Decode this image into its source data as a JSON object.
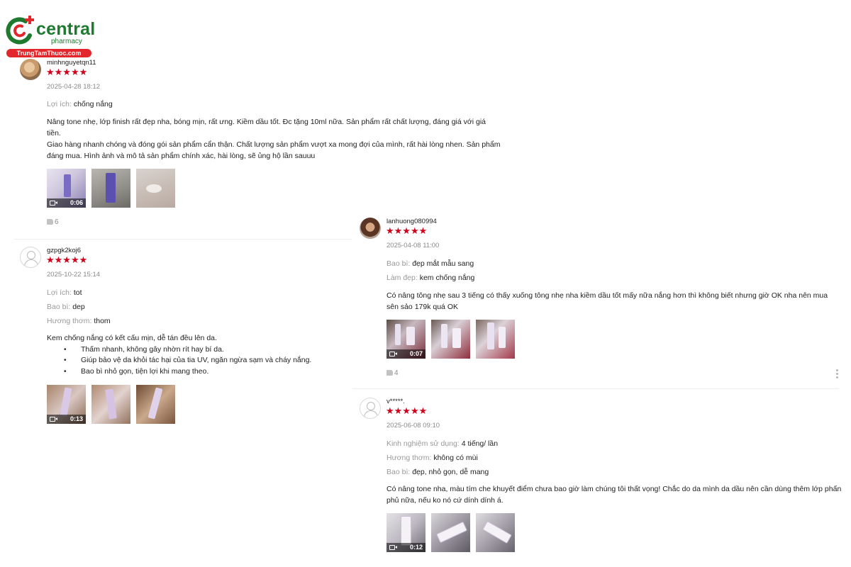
{
  "logo": {
    "brand": "central",
    "sub": "pharmacy",
    "url": "TrungTamThuoc.com"
  },
  "reviews": [
    {
      "username": "minhnguyetqn11",
      "stars": "★★★★★",
      "rating": 5,
      "date": "2025-04-28 18:12",
      "attributes": [
        {
          "label": "Lợi ích:",
          "value": "chống nắng"
        }
      ],
      "paragraphs": [
        "Nâng tone nhẹ, lớp finish rất đẹp nha, bóng mịn, rất ưng. Kiềm dầu tốt. Đc tặng 10ml nữa. Sản phẩm rất chất lượng, đáng giá với giá tiền.",
        "Giao hàng nhanh chóng và đóng gói sản phẩm cẩn thận. Chất lượng sản phẩm vượt xa mong đợi của mình, rất hài lòng nhen. Sản phẩm đáng mua. Hình ảnh và mô tả sản phẩm chính xác, hài lòng, sẽ ủng hộ lần sauuu"
      ],
      "video_duration": "0:06",
      "likes": "6"
    },
    {
      "username": "gzpgk2koj6",
      "stars": "★★★★★",
      "rating": 5,
      "date": "2025-10-22 15:14",
      "attributes": [
        {
          "label": "Lợi ích:",
          "value": "tot"
        },
        {
          "label": "Bao bì:",
          "value": "dep"
        },
        {
          "label": "Hương thơm:",
          "value": "thom"
        }
      ],
      "intro": "Kem chống nắng có kết cấu mịn, dễ tán đều lên da.",
      "bullets": [
        "Thấm nhanh, không gây nhờn rít hay bí da.",
        "Giúp bảo vệ da khỏi tác hại của tia UV, ngăn ngừa sạm và cháy nắng.",
        "Bao bì nhỏ gọn, tiện lợi khi mang theo."
      ],
      "video_duration": "0:13"
    },
    {
      "username": "lanhuong080994",
      "stars": "★★★★★",
      "rating": 5,
      "date": "2025-04-08 11:00",
      "attributes": [
        {
          "label": "Bao bì:",
          "value": "đẹp mắt mẫu sang"
        },
        {
          "label": "Làm đẹp:",
          "value": "kem chống nắng"
        }
      ],
      "paragraphs": [
        "Có nâng tông nhẹ sau 3 tiếng có thấy xuống tông nhẹ nha kiềm dầu tốt mấy nữa nắng hơn thì không biết nhưng giờ OK nha nên mua sên sảo 179k quá OK"
      ],
      "video_duration": "0:07",
      "likes": "4"
    },
    {
      "username": "v*****.",
      "stars": "★★★★★",
      "rating": 5,
      "date": "2025-06-08 09:10",
      "attributes": [
        {
          "label": "Kinh nghiệm sử dụng:",
          "value": "4 tiếng/ lần"
        },
        {
          "label": "Hương thơm:",
          "value": "không có mùi"
        },
        {
          "label": "Bao bì:",
          "value": "đẹp, nhỏ gọn, dễ mang"
        }
      ],
      "paragraphs": [
        "Có nâng tone nha, màu tím che khuyết điểm chưa bao giờ làm chúng tôi thất vọng! Chắc do da mình da dầu nên cần dùng thêm lớp phấn phủ nữa, nếu ko nó cứ dính dính á."
      ],
      "video_duration": "0:12"
    }
  ],
  "colors": {
    "star": "#d0021b",
    "brand_green": "#1e7a2f",
    "brand_red": "#e3262b",
    "muted": "#9a9a9a"
  }
}
